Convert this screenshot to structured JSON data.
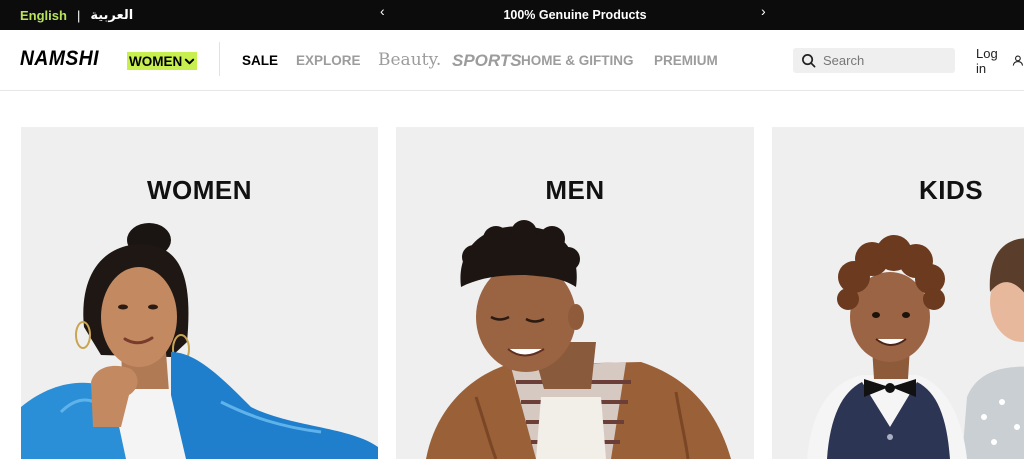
{
  "topbar": {
    "language_english": "English",
    "language_separator": "|",
    "language_arabic": "العربية",
    "announcement": "100% Genuine Products",
    "prev_arrow": "‹",
    "next_arrow": "›"
  },
  "header": {
    "logo": "NAMSHI",
    "gender_selector": "WOMEN",
    "nav": [
      "SALE",
      "EXPLORE",
      "Beauty.",
      "SPORTS",
      "HOME & GIFTING",
      "PREMIUM"
    ],
    "search_placeholder": "Search",
    "login": "Log in"
  },
  "categories": [
    {
      "label": "WOMEN"
    },
    {
      "label": "MEN"
    },
    {
      "label": "KIDS"
    }
  ],
  "colors": {
    "topbar_bg": "#0c0c0c",
    "accent_lime": "#c7ef4f",
    "english_link": "#b7e35a",
    "card_bg": "#efefef",
    "nav_inactive": "#9c9c9c"
  }
}
